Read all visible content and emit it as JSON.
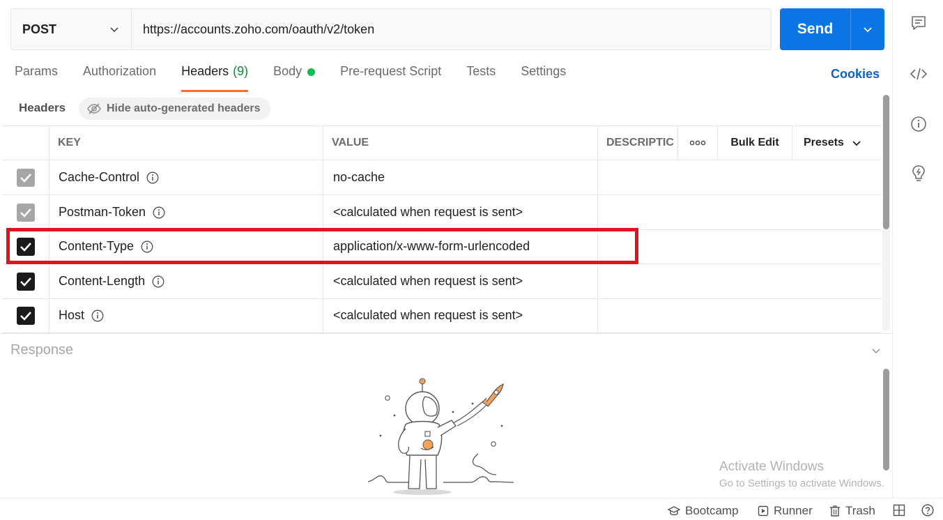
{
  "request": {
    "method": "POST",
    "url": "https://accounts.zoho.com/oauth/v2/token",
    "send_label": "Send"
  },
  "tabs": [
    {
      "label": "Params"
    },
    {
      "label": "Authorization"
    },
    {
      "label": "Headers",
      "count": "(9)",
      "active": true
    },
    {
      "label": "Body",
      "has_dot": true
    },
    {
      "label": "Pre-request Script"
    },
    {
      "label": "Tests"
    },
    {
      "label": "Settings"
    }
  ],
  "cookies_label": "Cookies",
  "headers_section": {
    "title": "Headers",
    "hide_auto_label": "Hide auto-generated headers"
  },
  "table": {
    "columns": {
      "key": "KEY",
      "value": "VALUE",
      "description": "DESCRIPTIC",
      "more": "ooo",
      "bulk_edit": "Bulk Edit",
      "presets": "Presets"
    },
    "rows": [
      {
        "key": "Cache-Control",
        "value": "no-cache",
        "checked": true,
        "auto": true
      },
      {
        "key": "Postman-Token",
        "value": "<calculated when request is sent>",
        "checked": true,
        "auto": true
      },
      {
        "key": "Content-Type",
        "value": "application/x-www-form-urlencoded",
        "checked": true,
        "auto": false,
        "highlighted": true
      },
      {
        "key": "Content-Length",
        "value": "<calculated when request is sent>",
        "checked": true,
        "auto": false
      },
      {
        "key": "Host",
        "value": "<calculated when request is sent>",
        "checked": true,
        "auto": false
      }
    ]
  },
  "response": {
    "title": "Response"
  },
  "watermark": {
    "line1": "Activate Windows",
    "line2": "Go to Settings to activate Windows."
  },
  "footer": {
    "bootcamp": "Bootcamp",
    "runner": "Runner",
    "trash": "Trash"
  },
  "colors": {
    "send": "#0c75e6",
    "active_tab_underline": "#ff6c37",
    "count_green": "#0c8a3a",
    "body_dot": "#0cbb52",
    "cookies_link": "#0b63c5",
    "highlight_box": "#e0141e"
  },
  "icons": {
    "method_dropdown": "chevron-down-icon",
    "send_dropdown": "chevron-down-icon",
    "rail": [
      "comment-icon",
      "code-icon",
      "info-icon",
      "lightbulb-icon"
    ],
    "hide_auto": "eye-slash-icon",
    "row_info": "info-icon",
    "footer": [
      "bootcamp-icon",
      "runner-icon",
      "trash-icon",
      "two-pane-icon",
      "help-icon"
    ]
  }
}
